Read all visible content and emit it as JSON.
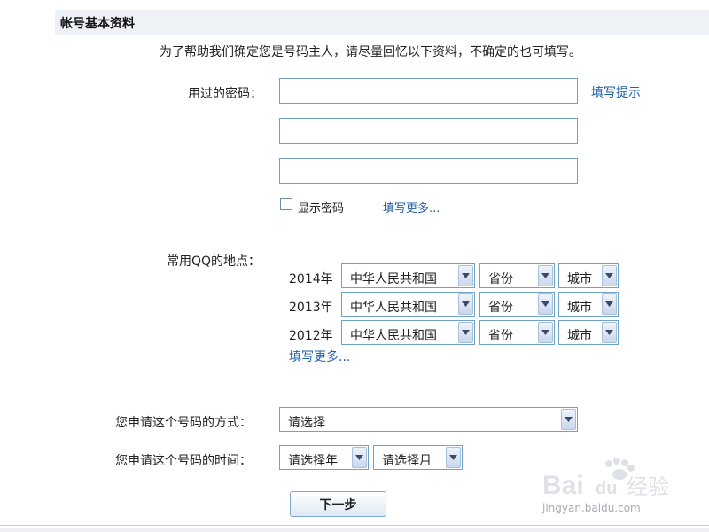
{
  "header": {
    "title": "帐号基本资料"
  },
  "intro": "为了帮助我们确定您是号码主人，请尽量回忆以下资料，不确定的也可填写。",
  "password_section": {
    "label": "用过的密码：",
    "fill_hint_link": "填写提示",
    "inputs": [
      "",
      "",
      ""
    ],
    "show_password_label": "显示密码",
    "show_password_checked": false,
    "more_link": "填写更多..."
  },
  "location_section": {
    "label": "常用QQ的地点：",
    "rows": [
      {
        "year": "2014年",
        "country": "中华人民共和国",
        "province": "省份",
        "city": "城市"
      },
      {
        "year": "2013年",
        "country": "中华人民共和国",
        "province": "省份",
        "city": "城市"
      },
      {
        "year": "2012年",
        "country": "中华人民共和国",
        "province": "省份",
        "city": "城市"
      }
    ],
    "more_link": "填写更多..."
  },
  "method_section": {
    "label": "您申请这个号码的方式：",
    "value": "请选择"
  },
  "time_section": {
    "label": "您申请这个号码的时间：",
    "year": "请选择年",
    "month": "请选择月"
  },
  "next_button": "下一步",
  "watermark": {
    "logo_text": "Baidu经验",
    "url_text": "jingyan.baidu.com"
  },
  "colors": {
    "input_border": "#6fa3c4",
    "link": "#1f5fa6",
    "header_bg": "#eef2f6"
  }
}
